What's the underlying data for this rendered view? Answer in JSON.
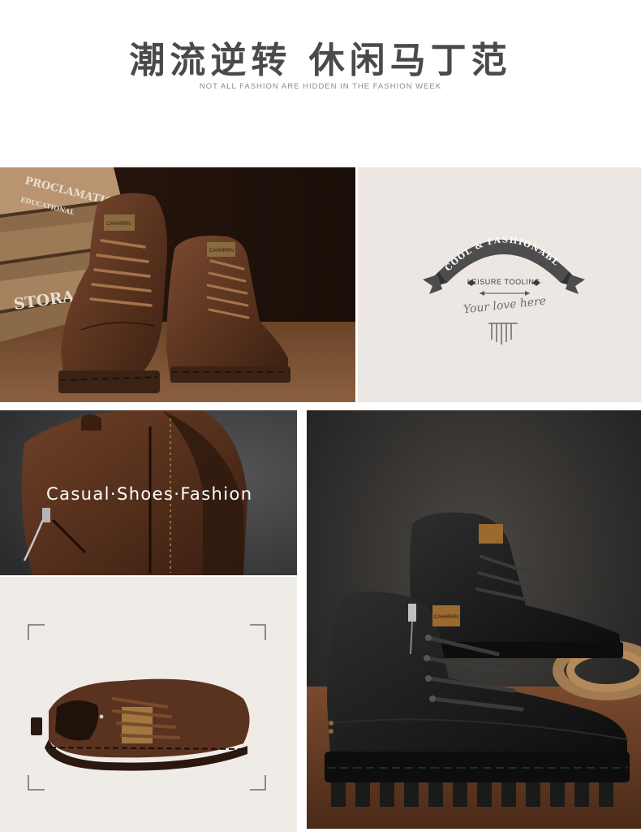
{
  "header": {
    "title": "潮流逆转 休闲马丁范",
    "subtitle": "NOT ALL FASHION ARE HIDDEN IN THE FASHION WEEK"
  },
  "crate_photo": {
    "crate_label_top": "PROCLAMATION",
    "crate_label_line2": "EDUCATIONAL",
    "crate_label_storage": "STORAGE",
    "boot_tag": "CAHHRRN"
  },
  "badge": {
    "ribbon_text": "COOL & FASHIONABLE",
    "subtext": "LEISURE TOOLING",
    "script_text": "Your love here"
  },
  "heel_photo": {
    "caption": "Casual·Shoes·Fashion"
  },
  "black_boot_photo": {
    "boot_tag": "CAHHRRN"
  },
  "colors": {
    "brown_leather": "#5a3320",
    "black_leather": "#1a1a1a",
    "panel_beige": "#ece7e2",
    "title_gray": "#4a4a4a"
  }
}
